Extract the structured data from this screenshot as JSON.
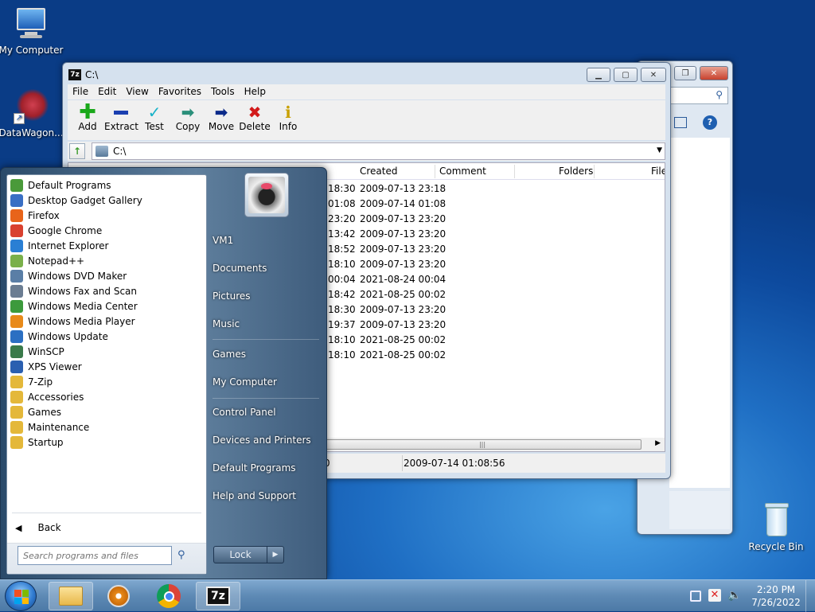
{
  "desktop": {
    "icons": [
      {
        "label": "My Computer"
      },
      {
        "label": "DataWagon..."
      },
      {
        "label": "Recycle Bin"
      }
    ]
  },
  "sevenzip": {
    "title": "C:\\",
    "menu": [
      "File",
      "Edit",
      "View",
      "Favorites",
      "Tools",
      "Help"
    ],
    "toolbar": [
      {
        "label": "Add",
        "icon": "plus-icon",
        "color": "#1aa81a"
      },
      {
        "label": "Extract",
        "icon": "minus-icon",
        "color": "#1a3fb0"
      },
      {
        "label": "Test",
        "icon": "check-icon",
        "color": "#16b2c8"
      },
      {
        "label": "Copy",
        "icon": "copy-arrow-icon",
        "color": "#2a8f7a"
      },
      {
        "label": "Move",
        "icon": "move-arrow-icon",
        "color": "#0b2a8a"
      },
      {
        "label": "Delete",
        "icon": "delete-x-icon",
        "color": "#d21a1a"
      },
      {
        "label": "Info",
        "icon": "info-icon",
        "color": "#c8a000"
      }
    ],
    "address": "C:\\",
    "columns": [
      "Created",
      "Comment",
      "Folders",
      "File"
    ],
    "rows": [
      {
        "modified": "18:30",
        "created": "2009-07-13 23:18"
      },
      {
        "modified": "01:08",
        "created": "2009-07-14 01:08"
      },
      {
        "modified": "23:20",
        "created": "2009-07-13 23:20"
      },
      {
        "modified": "13:42",
        "created": "2009-07-13 23:20"
      },
      {
        "modified": "18:52",
        "created": "2009-07-13 23:20"
      },
      {
        "modified": "18:10",
        "created": "2009-07-13 23:20"
      },
      {
        "modified": "00:04",
        "created": "2021-08-24 00:04"
      },
      {
        "modified": "18:42",
        "created": "2021-08-25 00:02"
      },
      {
        "modified": "18:30",
        "created": "2009-07-13 23:20"
      },
      {
        "modified": "19:37",
        "created": "2009-07-13 23:20"
      },
      {
        "modified": "18:10",
        "created": "2021-08-25 00:02"
      },
      {
        "modified": "18:10",
        "created": "2021-08-25 00:02"
      }
    ],
    "status_left": "0",
    "status_date": "2009-07-14 01:08:56"
  },
  "startmenu": {
    "programs": [
      {
        "label": "Default Programs",
        "color": "#4a9a3a"
      },
      {
        "label": "Desktop Gadget Gallery",
        "color": "#3a6fc4"
      },
      {
        "label": "Firefox",
        "color": "#e8641a"
      },
      {
        "label": "Google Chrome",
        "color": "#d9412f"
      },
      {
        "label": "Internet Explorer",
        "color": "#2a7fd4"
      },
      {
        "label": "Notepad++",
        "color": "#7ab04a"
      },
      {
        "label": "Windows DVD Maker",
        "color": "#5a7ea6"
      },
      {
        "label": "Windows Fax and Scan",
        "color": "#6b7d92"
      },
      {
        "label": "Windows Media Center",
        "color": "#3c9a3c"
      },
      {
        "label": "Windows Media Player",
        "color": "#e88a1a"
      },
      {
        "label": "Windows Update",
        "color": "#2b6fc2"
      },
      {
        "label": "WinSCP",
        "color": "#3a7a4a"
      },
      {
        "label": "XPS Viewer",
        "color": "#2a5fb0"
      },
      {
        "label": "7-Zip",
        "color": "#e4b83a"
      },
      {
        "label": "Accessories",
        "color": "#e4b83a"
      },
      {
        "label": "Games",
        "color": "#e4b83a"
      },
      {
        "label": "Maintenance",
        "color": "#e4b83a"
      },
      {
        "label": "Startup",
        "color": "#e4b83a"
      }
    ],
    "back_label": "Back",
    "search_placeholder": "Search programs and files",
    "right_items": [
      "VM1",
      "Documents",
      "Pictures",
      "Music",
      "Games",
      "My Computer",
      "Control Panel",
      "Devices and Printers",
      "Default Programs",
      "Help and Support"
    ],
    "lock_label": "Lock"
  },
  "taskbar": {
    "time": "2:20 PM",
    "date": "7/26/2022"
  }
}
